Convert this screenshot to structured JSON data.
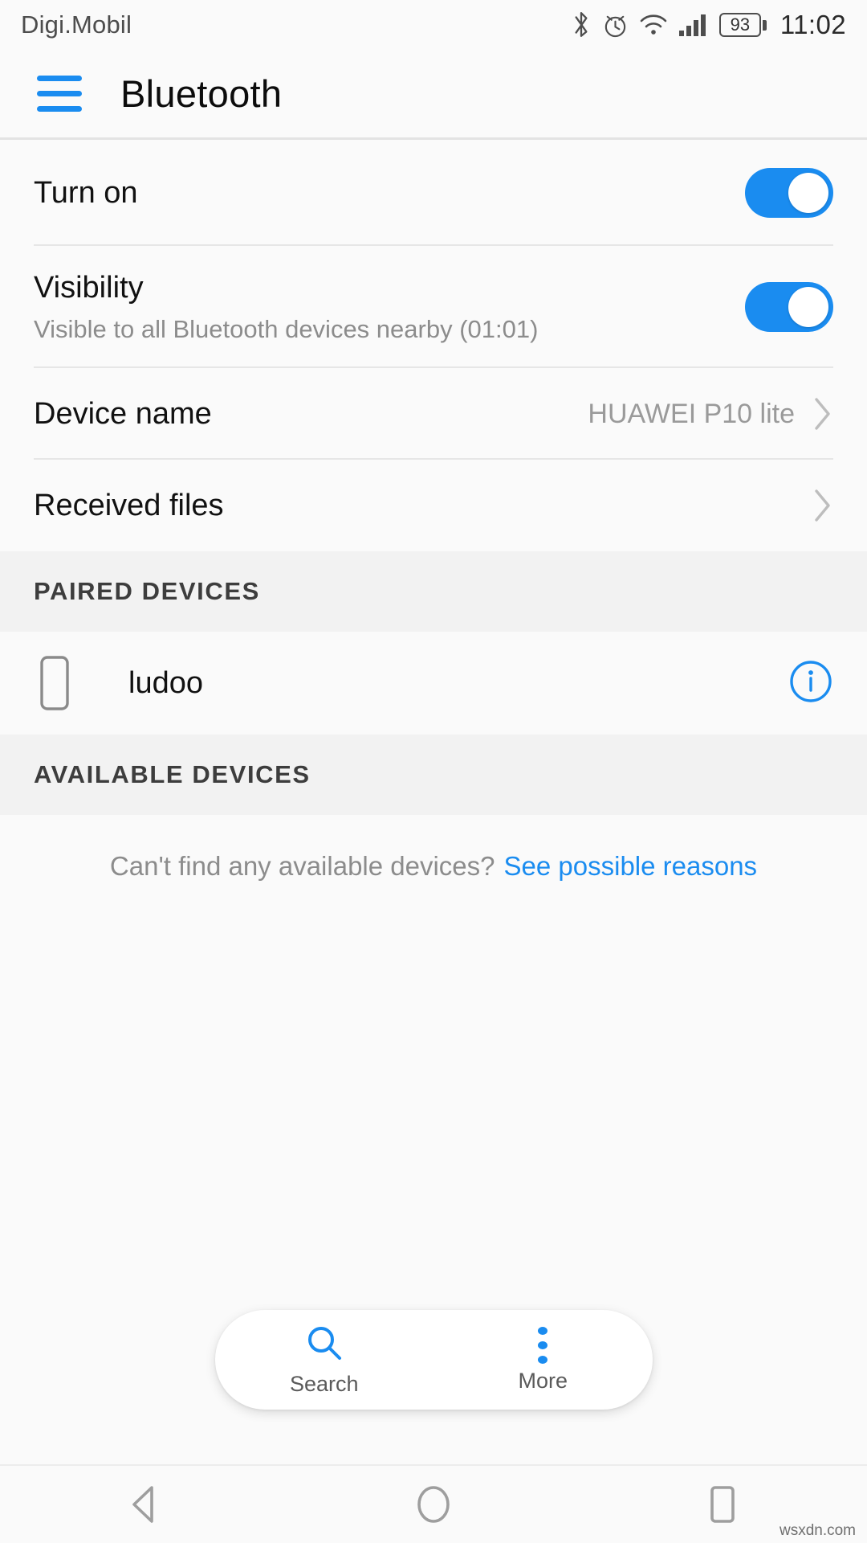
{
  "status_bar": {
    "carrier": "Digi.Mobil",
    "battery_percent": "93",
    "time": "11:02",
    "icons": [
      "bluetooth-icon",
      "alarm-icon",
      "wifi-icon",
      "signal-icon",
      "battery-icon"
    ]
  },
  "app_bar": {
    "menu_icon": "hamburger-menu-icon",
    "title": "Bluetooth"
  },
  "settings": {
    "turn_on": {
      "label": "Turn on",
      "toggle_state": "on",
      "highlighted": true
    },
    "visibility": {
      "label": "Visibility",
      "subtitle": "Visible to all Bluetooth devices nearby (01:01)",
      "toggle_state": "on"
    },
    "device_name": {
      "label": "Device name",
      "value": "HUAWEI P10 lite"
    },
    "received_files": {
      "label": "Received files"
    }
  },
  "paired_section": {
    "header": "PAIRED DEVICES",
    "devices": [
      {
        "name": "ludoo",
        "icon": "phone-device-icon",
        "action_icon": "info-circle-icon"
      }
    ]
  },
  "available_section": {
    "header": "AVAILABLE DEVICES",
    "empty_text": "Can't find any available devices?",
    "empty_link": "See possible reasons"
  },
  "action_bar": {
    "search_label": "Search",
    "search_icon": "search-icon",
    "more_label": "More",
    "more_icon": "more-vertical-icon"
  },
  "nav_bar": {
    "back_icon": "back-triangle-icon",
    "home_icon": "home-circle-icon",
    "recents_icon": "recents-square-icon"
  },
  "watermark": "wsxdn.com",
  "colors": {
    "accent": "#1a8cf0",
    "highlight": "#c62a2a",
    "page_bg": "#fafafa",
    "section_bg": "#f2f2f2"
  }
}
